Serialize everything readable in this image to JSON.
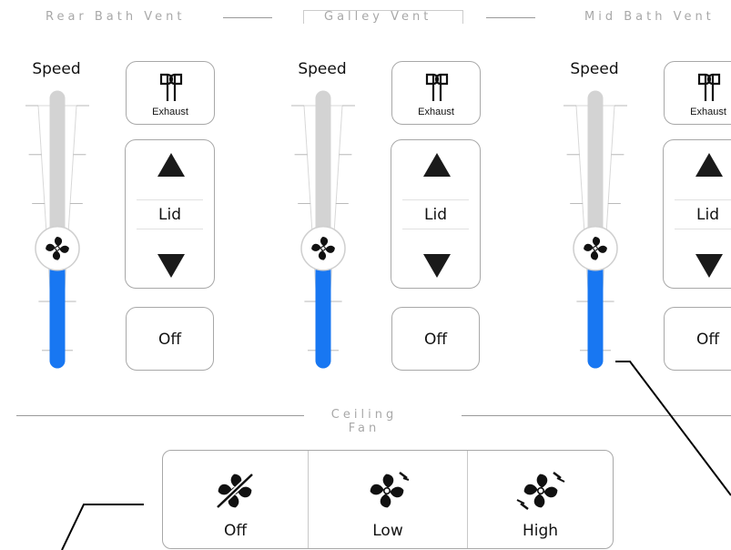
{
  "vents": [
    {
      "title": "Rear Bath Vent",
      "speed_label": "Speed",
      "exhaust_label": "Exhaust",
      "lid_label": "Lid",
      "off_label": "Off"
    },
    {
      "title": "Galley Vent",
      "speed_label": "Speed",
      "exhaust_label": "Exhaust",
      "lid_label": "Lid",
      "off_label": "Off"
    },
    {
      "title": "Mid Bath Vent",
      "speed_label": "Speed",
      "exhaust_label": "Exhaust",
      "lid_label": "Lid",
      "off_label": "Off"
    }
  ],
  "speed_level": 0.4,
  "ceiling_fan": {
    "title": "Ceiling Fan",
    "options": [
      {
        "label": "Off",
        "icon": "fan-off-icon"
      },
      {
        "label": "Low",
        "icon": "fan-low-icon"
      },
      {
        "label": "High",
        "icon": "fan-high-icon"
      }
    ]
  },
  "colors": {
    "fill_active": "#1877f2",
    "track": "#d3d3d3",
    "border": "#a8a8a8",
    "heading": "#a8a8a8"
  }
}
